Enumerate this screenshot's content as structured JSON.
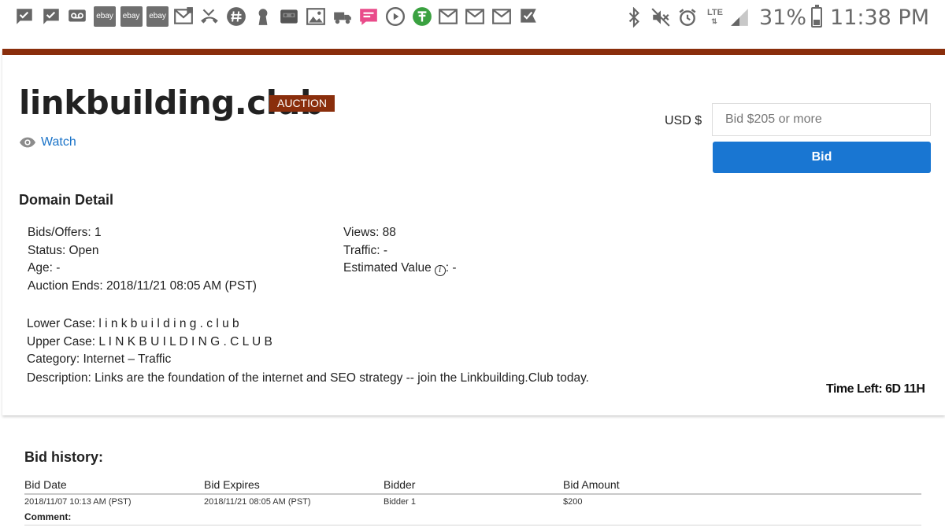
{
  "status_bar": {
    "left_icons": [
      "checkmark-message-icon",
      "checkmark-message-icon",
      "voicemail-icon",
      "ebay-icon",
      "ebay-icon",
      "ebay-icon",
      "email-icon",
      "missed-call-icon",
      "hashtag-icon",
      "keyhole-icon",
      "cassette-icon",
      "image-icon",
      "delivery-icon",
      "chat-icon",
      "play-icon",
      "news-icon",
      "mail-icon",
      "mail-icon",
      "mail-icon",
      "checkmark-message-icon"
    ],
    "ebay_label": "ebay",
    "right_icons": [
      "bluetooth-icon",
      "mute-icon",
      "alarm-icon",
      "lte-icon",
      "signal-icon",
      "battery-icon"
    ],
    "network": "LTE",
    "battery_percent": "31%",
    "battery_level": 0.31,
    "time": "11:38 PM"
  },
  "listing": {
    "domain": "linkbuilding.club",
    "badge": "AUCTION",
    "watch_label": "Watch",
    "brand_color": "#8a2e0c",
    "link_color": "#1a73c8"
  },
  "bid": {
    "currency": "USD $",
    "placeholder": "Bid $205 or more",
    "button_label": "Bid",
    "button_color": "#1976d2"
  },
  "domain_detail": {
    "heading": "Domain Detail",
    "bids_offers": "Bids/Offers: 1",
    "status": "Status: Open",
    "age": "Age: -",
    "auction_ends": "Auction Ends: 2018/11/21 08:05 AM (PST)",
    "views": "Views: 88",
    "traffic": "Traffic: -",
    "estimated_value_label": "Estimated Value",
    "estimated_value": ": -",
    "lower_case": "Lower Case: l i n k b u i l d i n g . c l u b",
    "upper_case": "Upper Case: L I N K B U I L D I N G . C L U B",
    "category": "Category: Internet – Traffic",
    "description": "Description: Links are the foundation of the internet and SEO strategy -- join the Linkbuilding.Club today."
  },
  "time_left": "Time Left: 6D 11H",
  "bid_history": {
    "title": "Bid history:",
    "columns": [
      "Bid Date",
      "Bid Expires",
      "Bidder",
      "Bid Amount"
    ],
    "rows": [
      [
        "2018/11/07 10:13 AM (PST)",
        "2018/11/21 08:05 AM (PST)",
        "Bidder 1",
        "$200"
      ]
    ],
    "comment_label": "Comment:"
  }
}
